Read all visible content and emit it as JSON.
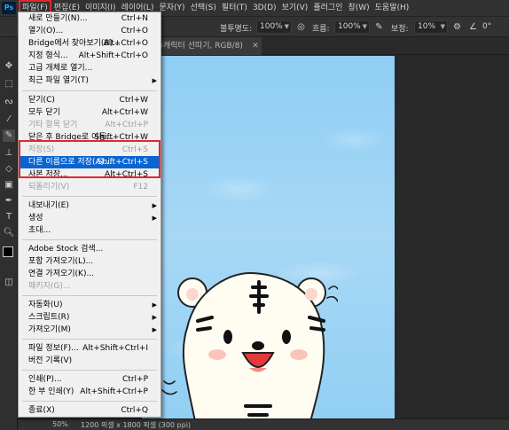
{
  "app": {
    "logo": "Ps"
  },
  "menubar": {
    "items": [
      "파일(F)",
      "편집(E)",
      "이미지(I)",
      "레이어(L)",
      "문자(Y)",
      "선택(S)",
      "필터(T)",
      "3D(D)",
      "보기(V)",
      "플러그인",
      "창(W)",
      "도움말(H)"
    ]
  },
  "options": {
    "opacity_label": "불투명도:",
    "opacity_value": "100%",
    "flow_label": "흐름:",
    "flow_value": "100%",
    "smoothing_label": "보정:",
    "smoothing_value": "10%",
    "angle_value": "0°"
  },
  "document": {
    "tab_title": "@캐릭터 선따기, RGB/8)",
    "zoom": "50%",
    "info": "1200 픽셀 x 1800 픽셀 (300 ppi)"
  },
  "file_menu": {
    "items": [
      {
        "label": "새로 만들기(N)...",
        "shortcut": "Ctrl+N"
      },
      {
        "label": "열기(O)...",
        "shortcut": "Ctrl+O"
      },
      {
        "label": "Bridge에서 찾아보기(B)...",
        "shortcut": "Alt+Ctrl+O"
      },
      {
        "label": "지정 형식...",
        "shortcut": "Alt+Shift+Ctrl+O"
      },
      {
        "label": "고급 개체로 열기...",
        "shortcut": ""
      },
      {
        "label": "최근 파일 열기(T)",
        "shortcut": "",
        "submenu": true
      },
      {
        "label": "닫기(C)",
        "shortcut": "Ctrl+W"
      },
      {
        "label": "모두 닫기",
        "shortcut": "Alt+Ctrl+W"
      },
      {
        "label": "기타 항목 닫기",
        "shortcut": "Alt+Ctrl+P",
        "disabled": true
      },
      {
        "label": "닫은 후 Bridge로 이동...",
        "shortcut": "Shift+Ctrl+W"
      },
      {
        "label": "저장(S)",
        "shortcut": "Ctrl+S",
        "disabled": true
      },
      {
        "label": "다른 이름으로 저장(A)...",
        "shortcut": "Shift+Ctrl+S",
        "highlighted": true
      },
      {
        "label": "사본 저장...",
        "shortcut": "Alt+Ctrl+S"
      },
      {
        "label": "되돌리기(V)",
        "shortcut": "F12",
        "disabled": true
      },
      {
        "label": "내보내기(E)",
        "shortcut": "",
        "submenu": true
      },
      {
        "label": "생성",
        "shortcut": "",
        "submenu": true
      },
      {
        "label": "초대...",
        "shortcut": ""
      },
      {
        "label": "Adobe Stock 검색...",
        "shortcut": ""
      },
      {
        "label": "포함 가져오기(L)...",
        "shortcut": ""
      },
      {
        "label": "연결 가져오기(K)...",
        "shortcut": ""
      },
      {
        "label": "패키지(G)...",
        "shortcut": "",
        "disabled": true
      },
      {
        "label": "자동화(U)",
        "shortcut": "",
        "submenu": true
      },
      {
        "label": "스크립트(R)",
        "shortcut": "",
        "submenu": true
      },
      {
        "label": "가져오기(M)",
        "shortcut": "",
        "submenu": true
      },
      {
        "label": "파일 정보(F)...",
        "shortcut": "Alt+Shift+Ctrl+I"
      },
      {
        "label": "버전 기록(V)",
        "shortcut": ""
      },
      {
        "label": "인쇄(P)...",
        "shortcut": "Ctrl+P"
      },
      {
        "label": "한 부 인쇄(Y)",
        "shortcut": "Alt+Shift+Ctrl+P"
      },
      {
        "label": "종료(X)",
        "shortcut": "Ctrl+Q"
      }
    ]
  },
  "tools": [
    "move-icon",
    "marquee-icon",
    "lasso-icon",
    "crop-icon",
    "eyedropper-icon",
    "brush-icon",
    "stamp-icon",
    "eraser-icon",
    "gradient-icon",
    "pen-icon",
    "type-icon",
    "shape-icon",
    "zoom-icon"
  ]
}
